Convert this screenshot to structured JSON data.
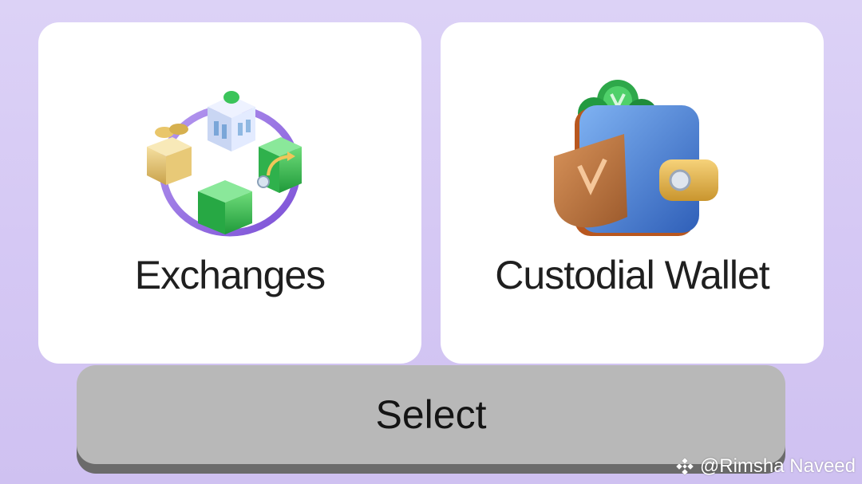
{
  "cards": [
    {
      "label": "Exchanges",
      "icon": "exchange-cycle-icon"
    },
    {
      "label": "Custodial Wallet",
      "icon": "wallet-icon"
    }
  ],
  "select_button": {
    "label": "Select"
  },
  "watermark": {
    "text": "@Rimsha Naveed",
    "icon": "binance-logo-icon"
  },
  "colors": {
    "background": "#d8ccf5",
    "card": "#ffffff",
    "button": "#b8b8b8",
    "button_shadow": "#6b6b6b",
    "text": "#1f1f1f"
  }
}
